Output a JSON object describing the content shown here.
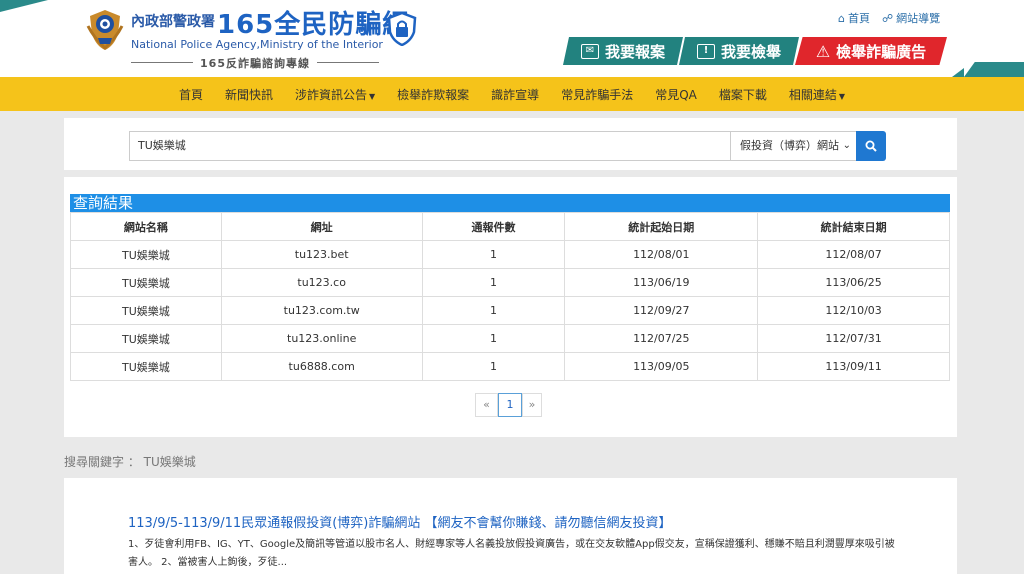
{
  "header": {
    "agency_zh": "內政部警政署",
    "site_name": "165全民防騙網",
    "agency_en": "National Police Agency,Ministry of the Interior",
    "hotline": "165反詐騙諮詢專線",
    "util_home": "首頁",
    "util_sitemap": "網站導覽",
    "btn_report": "我要報案",
    "btn_tip": "我要檢舉",
    "btn_ad": "檢舉詐騙廣告",
    "brand_color": "#1e63c2",
    "teal_color": "#22827f",
    "red_color": "#e0262c"
  },
  "nav": {
    "items": [
      {
        "label": "首頁",
        "dropdown": false
      },
      {
        "label": "新聞快訊",
        "dropdown": false
      },
      {
        "label": "涉詐資訊公告",
        "dropdown": true
      },
      {
        "label": "檢舉詐欺報案",
        "dropdown": false
      },
      {
        "label": "識詐宣導",
        "dropdown": false
      },
      {
        "label": "常見詐騙手法",
        "dropdown": false
      },
      {
        "label": "常見QA",
        "dropdown": false
      },
      {
        "label": "檔案下載",
        "dropdown": false
      },
      {
        "label": "相關連結",
        "dropdown": true
      }
    ],
    "bg_color": "#f5c31a"
  },
  "search": {
    "query": "TU娛樂城",
    "category": "假投資（博弈）網站"
  },
  "results": {
    "title": "查詢結果",
    "headers": [
      "網站名稱",
      "網址",
      "通報件數",
      "統計起始日期",
      "統計結束日期"
    ],
    "rows": [
      [
        "TU娛樂城",
        "tu123.bet",
        "1",
        "112/08/01",
        "112/08/07"
      ],
      [
        "TU娛樂城",
        "tu123.co",
        "1",
        "113/06/19",
        "113/06/25"
      ],
      [
        "TU娛樂城",
        "tu123.com.tw",
        "1",
        "112/09/27",
        "112/10/03"
      ],
      [
        "TU娛樂城",
        "tu123.online",
        "1",
        "112/07/25",
        "112/07/31"
      ],
      [
        "TU娛樂城",
        "tu6888.com",
        "1",
        "113/09/05",
        "113/09/11"
      ]
    ]
  },
  "pager": {
    "prev": "«",
    "current": "1",
    "next": "»"
  },
  "keyword_line": "搜尋關鍵字 ： TU娛樂城",
  "article": {
    "title": "113/9/5-113/9/11民眾通報假投資(博弈)詐騙網站 【網友不會幫你賺錢、請勿聽信網友投資】",
    "body": "1、歹徒會利用FB、IG、YT、Google及簡訊等管道以股市名人、財經專家等人名義投放假投資廣告，或在交友軟體App假交友，宣稱保證獲利、穩賺不賠且利潤豐厚來吸引被害人。 2、當被害人上鉤後，歹徒..."
  }
}
